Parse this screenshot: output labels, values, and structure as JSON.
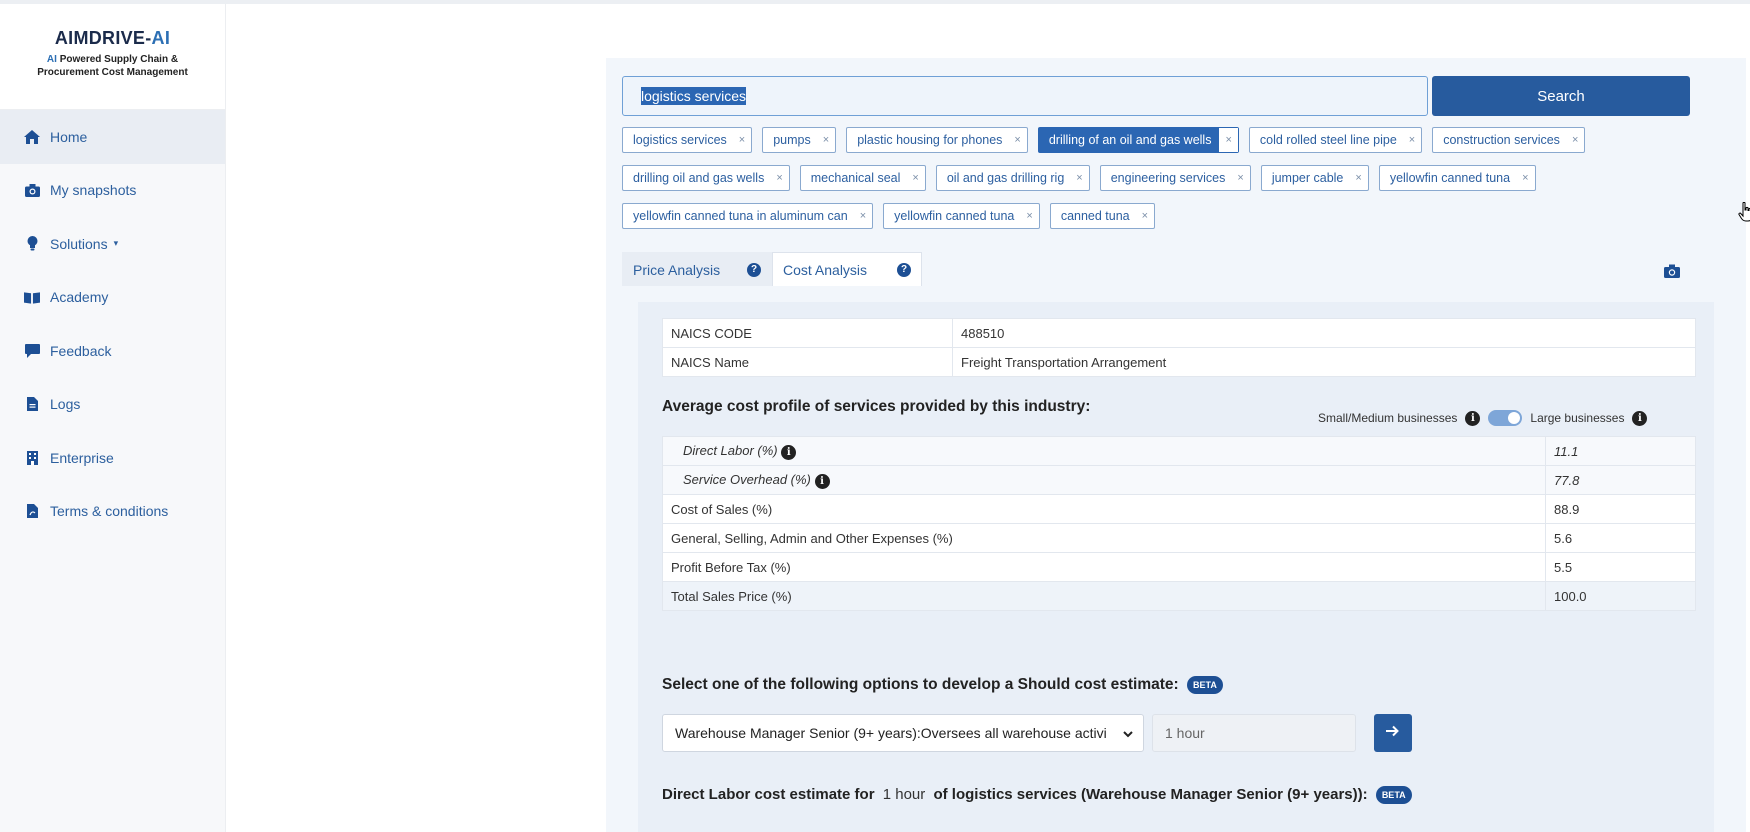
{
  "brand": {
    "title_a": "AI",
    "title_b": "MDRIVE-",
    "title_c": "AI",
    "sub_a": "AI",
    "sub_b": " Powered Supply Chain &",
    "sub_line2": "Procurement Cost Management"
  },
  "sidebar": {
    "items": [
      {
        "label": "Home",
        "icon": "home-icon"
      },
      {
        "label": "My snapshots",
        "icon": "camera-icon"
      },
      {
        "label": "Solutions",
        "icon": "lightbulb-icon"
      },
      {
        "label": "Academy",
        "icon": "book-icon"
      },
      {
        "label": "Feedback",
        "icon": "comment-icon"
      },
      {
        "label": "Logs",
        "icon": "file-icon"
      },
      {
        "label": "Enterprise",
        "icon": "building-icon"
      },
      {
        "label": "Terms & conditions",
        "icon": "pdf-file-icon"
      }
    ]
  },
  "search": {
    "value": "logistics services",
    "button_label": "Search"
  },
  "chips": {
    "row1": [
      "logistics services",
      "pumps",
      "plastic housing for phones",
      "drilling of an oil and gas wells",
      "cold rolled steel line pipe",
      "construction services"
    ],
    "row2": [
      "drilling oil and gas wells",
      "mechanical seal",
      "oil and gas drilling rig",
      "engineering services",
      "jumper cable",
      "yellowfin canned tuna"
    ],
    "row3": [
      "yellowfin canned tuna in aluminum can",
      "yellowfin canned tuna",
      "canned tuna"
    ],
    "close_glyph": "×"
  },
  "tabs": {
    "price": "Price Analysis",
    "cost": "Cost Analysis",
    "help_glyph": "?"
  },
  "naics": {
    "code_label": "NAICS CODE",
    "code_value": "488510",
    "name_label": "NAICS Name",
    "name_value": "Freight Transportation Arrangement"
  },
  "cost_profile": {
    "title": "Average cost profile of services provided by this industry:",
    "small_label": "Small/Medium businesses",
    "large_label": "Large businesses",
    "info_glyph": "i",
    "rows": {
      "direct_labor": {
        "label": "Direct Labor (%)",
        "value": "11.1"
      },
      "service_overhead": {
        "label": "Service Overhead (%)",
        "value": "77.8"
      },
      "cost_of_sales": {
        "label": "Cost of Sales (%)",
        "value": "88.9"
      },
      "gsa": {
        "label": "General, Selling, Admin and Other Expenses (%)",
        "value": "5.6"
      },
      "profit": {
        "label": "Profit Before Tax (%)",
        "value": "5.5"
      },
      "total": {
        "label": "Total Sales Price (%)",
        "value": "100.0"
      }
    }
  },
  "should_cost": {
    "title": "Select one of the following options to develop a Should cost estimate:",
    "beta": "BETA",
    "selected_option": "Warehouse Manager Senior (9+ years):Oversees all warehouse activi",
    "hours_value": "1 hour"
  },
  "direct_labor_line": {
    "prefix": "Direct Labor cost estimate for",
    "hours": "1 hour",
    "suffix": "of logistics services (Warehouse Manager Senior (9+ years)):",
    "beta": "BETA"
  }
}
